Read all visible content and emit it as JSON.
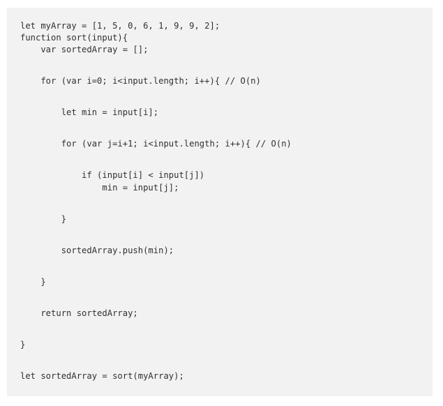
{
  "code": {
    "lines": [
      {
        "text": "let myArray = [1, 5, 0, 6, 1, 9, 9, 2];"
      },
      {
        "text": "function sort(input){"
      },
      {
        "text": "    var sortedArray = [];"
      },
      {
        "text": "    for (var i=0; i<input.length; i++){ // O(n)"
      },
      {
        "text": "        let min = input[i];"
      },
      {
        "text": "        for (var j=i+1; i<input.length; i++){ // O(n)"
      },
      {
        "text": "            if (input[i] < input[j])"
      },
      {
        "text": "                min = input[j];"
      },
      {
        "text": "        }"
      },
      {
        "text": "        sortedArray.push(min);"
      },
      {
        "text": "    }"
      },
      {
        "text": "    return sortedArray;"
      },
      {
        "text": "}"
      },
      {
        "text": "let sortedArray = sort(myArray);"
      }
    ]
  }
}
